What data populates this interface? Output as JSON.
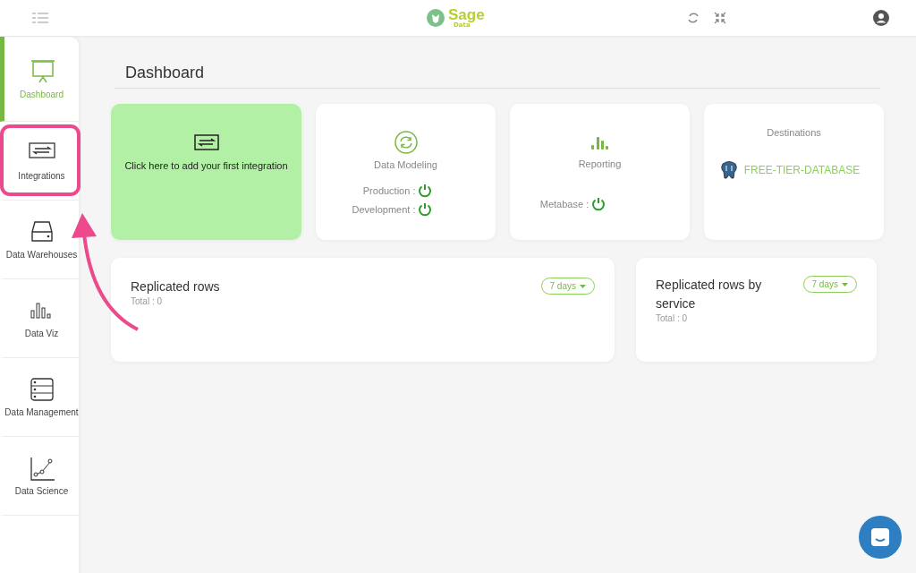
{
  "header": {
    "logo_word": "Sage",
    "logo_sub": "Data"
  },
  "sidebar": {
    "items": [
      {
        "label": "Dashboard",
        "kind": "dashboard",
        "selected": true
      },
      {
        "label": "Integrations",
        "kind": "integrations",
        "selected": false
      },
      {
        "label": "Data Warehouses",
        "kind": "warehouses",
        "selected": false
      },
      {
        "label": "Data Viz",
        "kind": "viz",
        "selected": false
      },
      {
        "label": "Data Management",
        "kind": "management",
        "selected": false
      },
      {
        "label": "Data Science",
        "kind": "science",
        "selected": false
      }
    ]
  },
  "page_title": "Dashboard",
  "cards": [
    {
      "kind": "add",
      "text": "Click here to add your first integration"
    },
    {
      "kind": "modeling",
      "title": "Data Modeling",
      "lines": [
        "Production :",
        "Development :"
      ]
    },
    {
      "kind": "reporting",
      "title": "Reporting",
      "lines": [
        "Metabase :"
      ]
    },
    {
      "kind": "destinations",
      "title": "Destinations",
      "database": "FREE-TIER-DATABASE"
    }
  ],
  "panels": [
    {
      "title": "Replicated rows",
      "total": "Total : 0",
      "range": "7 days"
    },
    {
      "title": "Replicated rows by service",
      "total": "Total : 0",
      "range": "7 days"
    }
  ]
}
